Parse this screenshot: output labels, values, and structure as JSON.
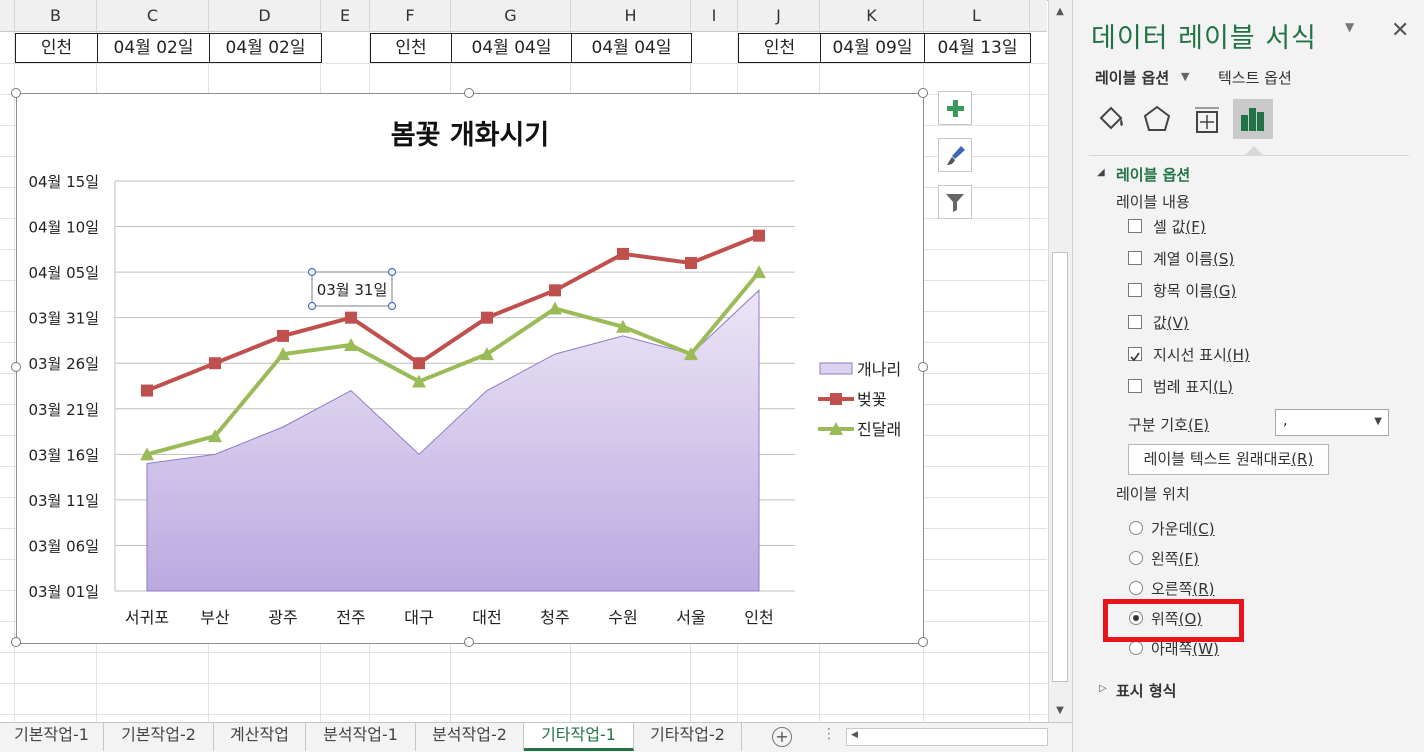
{
  "columns": [
    "B",
    "C",
    "D",
    "E",
    "F",
    "G",
    "H",
    "I",
    "J",
    "K",
    "L"
  ],
  "row_cells": [
    "인천",
    "04월 02일",
    "04월 02일",
    "",
    "인천",
    "04월 04일",
    "04월 04일",
    "",
    "인천",
    "04월 09일",
    "04월 13일"
  ],
  "chart_data": {
    "type": "line",
    "title": "봄꽃 개화시기",
    "categories": [
      "서귀포",
      "부산",
      "광주",
      "전주",
      "대구",
      "대전",
      "청주",
      "수원",
      "서울",
      "인천"
    ],
    "y_ticks": [
      "04월 15일",
      "04월 10일",
      "04월 05일",
      "03월 31일",
      "03월 26일",
      "03월 21일",
      "03월 16일",
      "03월 11일",
      "03월 06일",
      "03월 01일"
    ],
    "ylim": [
      "03월 01일",
      "04월 15일"
    ],
    "grid": true,
    "legend_position": "right",
    "series": [
      {
        "name": "개나리",
        "type": "area",
        "color": "#c4b5e3",
        "values": [
          "03월 15일",
          "03월 16일",
          "03월 19일",
          "03월 23일",
          "03월 16일",
          "03월 23일",
          "03월 27일",
          "03월 29일",
          "03월 27일",
          "04월 03일"
        ]
      },
      {
        "name": "벚꽃",
        "type": "line",
        "marker": "square",
        "color": "#c0504d",
        "values": [
          "03월 23일",
          "03월 26일",
          "03월 29일",
          "03월 31일",
          "03월 26일",
          "03월 31일",
          "04월 03일",
          "04월 07일",
          "04월 06일",
          "04월 09일"
        ]
      },
      {
        "name": "진달래",
        "type": "line",
        "marker": "triangle",
        "color": "#9bbb59",
        "values": [
          "03월 16일",
          "03월 18일",
          "03월 27일",
          "03월 28일",
          "03월 24일",
          "03월 27일",
          "04월 01일",
          "03월 30일",
          "03월 27일",
          "04월 05일"
        ]
      }
    ],
    "selected_data_label": "03월 31일"
  },
  "tabs": [
    "기본작업-1",
    "기본작업-2",
    "계산작업",
    "분석작업-1",
    "분석작업-2",
    "기타작업-1",
    "기타작업-2"
  ],
  "active_tab": "기타작업-1",
  "pane": {
    "title": "데이터 레이블 서식",
    "tab_label_options": "레이블 옵션",
    "tab_text_options": "텍스트 옵션",
    "section_label_options": "레이블 옵션",
    "label_contains": "레이블 내용",
    "checkboxes": [
      {
        "label": "셀 값",
        "key": "(F)",
        "checked": false
      },
      {
        "label": "계열 이름",
        "key": "(S)",
        "checked": false
      },
      {
        "label": "항목 이름",
        "key": "(G)",
        "checked": false
      },
      {
        "label": "값",
        "key": "(V)",
        "checked": false
      },
      {
        "label": "지시선 표시",
        "key": "(H)",
        "checked": true
      },
      {
        "label": "범례 표지",
        "key": "(L)",
        "checked": false
      }
    ],
    "separator_label": "구분 기호",
    "separator_key": "(E)",
    "separator_value": ",",
    "reset_button": "레이블 텍스트 원래대로",
    "reset_key": "(R)",
    "label_position": "레이블 위치",
    "radios": [
      {
        "label": "가운데",
        "key": "(C)",
        "selected": false
      },
      {
        "label": "왼쪽",
        "key": "(F)",
        "selected": false
      },
      {
        "label": "오른쪽",
        "key": "(R)",
        "selected": false
      },
      {
        "label": "위쪽",
        "key": "(O)",
        "selected": true
      },
      {
        "label": "아래쪽",
        "key": "(W)",
        "selected": false
      }
    ],
    "number_section": "표시 형식",
    "highlight_color": "#e8141a",
    "accent": "#217346"
  }
}
